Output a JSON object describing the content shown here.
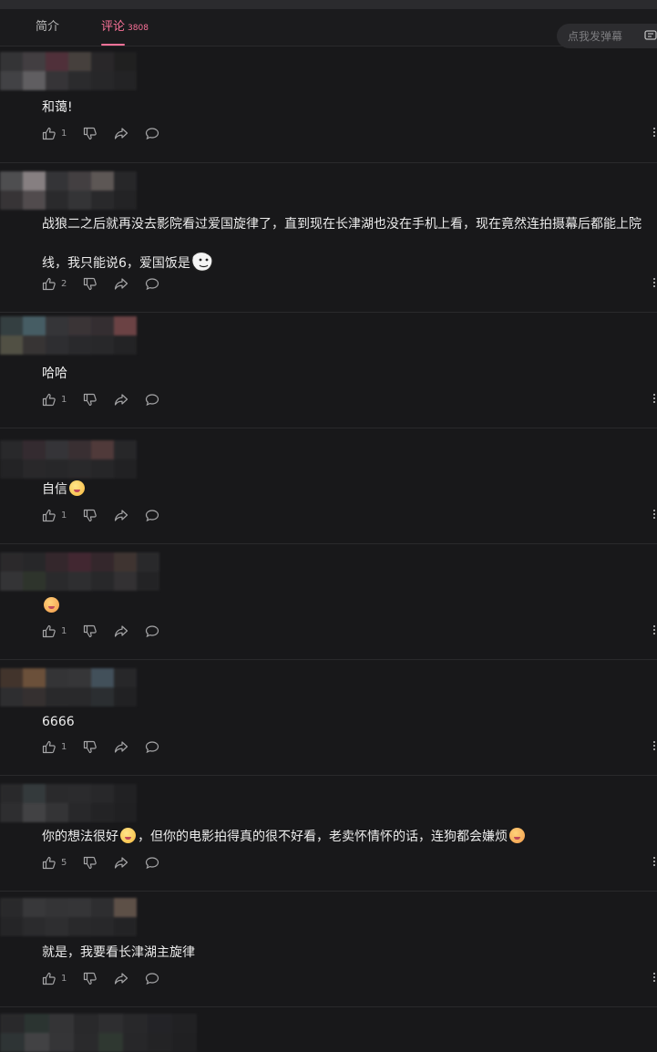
{
  "tabs": {
    "intro": "简介",
    "comments": "评论",
    "comment_count": "3808"
  },
  "danmaku": {
    "placeholder": "点我发弹幕"
  },
  "colors": {
    "accent": "#fb7299",
    "background": "#18181a"
  },
  "icons": [
    "like-icon",
    "dislike-icon",
    "share-icon",
    "reply-icon",
    "more-icon",
    "danmaku-settings-icon"
  ],
  "comments": [
    {
      "text": "和蔼!",
      "likes": "1"
    },
    {
      "text_line1": "战狼二之后就再没去影院看过爱国旋律了，直到现在长津湖也没在手机上看，现在竟然连拍摄幕后都能上院",
      "text_line2": "线，我只能说6，爱国饭是",
      "likes": "2"
    },
    {
      "text": "哈哈",
      "likes": "1"
    },
    {
      "text": "自信",
      "likes": "1"
    },
    {
      "text": "",
      "likes": "1"
    },
    {
      "text": "6666",
      "likes": "1"
    },
    {
      "text_part1": "你的想法很好",
      "text_part2": "，但你的电影拍得真的很不好看，老卖怀情怀的话，连狗都会嫌烦",
      "likes": "5"
    },
    {
      "text": "就是，我要看长津湖主旋律",
      "likes": "1"
    }
  ]
}
